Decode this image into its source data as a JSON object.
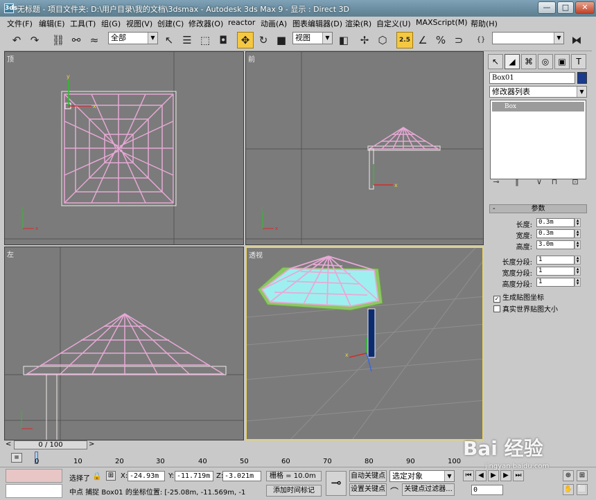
{
  "window": {
    "title": "无标题    - 项目文件夹: D:\\用户目录\\我的文档\\3dsmax    - Autodesk 3ds Max 9    - 显示 : Direct 3D",
    "app_icon": "3ds",
    "minimize": "—",
    "maximize": "□",
    "close": "✕"
  },
  "menu": [
    "编辑(E)",
    "工具(T)",
    "组(G)",
    "视图(V)",
    "创建(C)",
    "修改器(O)",
    "reactor",
    "动画(A)",
    "图表编辑器(D)",
    "渲染(R)",
    "自定义(U)",
    "MAXScript(M)",
    "帮助(H)"
  ],
  "file_menu": "文件(F)",
  "toolbar": {
    "selection_filter": "全部",
    "ref_coord": "视图",
    "snap_value": "2.5",
    "named_selection": ""
  },
  "viewports": {
    "top": "顶",
    "front": "前",
    "left": "左",
    "perspective": "透视"
  },
  "command_panel": {
    "object_name": "Box01",
    "object_color": "#1a3b8c",
    "modifier_list": "修改器列表",
    "stack_item": "Box",
    "rollout": "参数",
    "params": [
      {
        "label": "长度:",
        "value": "0.3m"
      },
      {
        "label": "宽度:",
        "value": "0.3m"
      },
      {
        "label": "高度:",
        "value": "3.0m"
      },
      {
        "label": "长度分段:",
        "value": "1"
      },
      {
        "label": "宽度分段:",
        "value": "1"
      },
      {
        "label": "高度分段:",
        "value": "1"
      }
    ],
    "gen_mapping": "生成贴图坐标",
    "gen_mapping_checked": "✓",
    "real_world": "真实世界贴图大小"
  },
  "timeline": {
    "position": "0 / 100",
    "ticks": [
      "0",
      "10",
      "20",
      "30",
      "40",
      "50",
      "60",
      "70",
      "80",
      "90",
      "100"
    ]
  },
  "status": {
    "selection_label": "选择了",
    "x": "-24.93m",
    "y": "-11.719m",
    "z": "-3.021m",
    "grid": "栅格 = 10.0m",
    "auto_key": "自动关键点",
    "set_key": "设置关键点",
    "selected_object": "选定对象",
    "key_filters": "关键点过滤器...",
    "prompt": "中点  捕捉 Box01 的坐标位置: [-25.08m, -11.569m, -1",
    "add_time_tag": "添加时间标记",
    "frame": "0"
  },
  "watermark": "Bai 经验",
  "watermark_url": "jingyan.baidu.com"
}
